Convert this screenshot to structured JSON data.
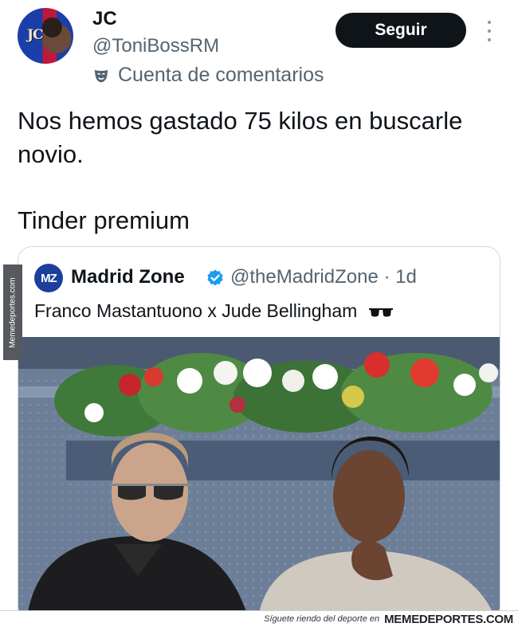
{
  "author": {
    "avatar_text": "JC",
    "display_name": "JC",
    "handle": "@ToniBossRM",
    "account_label": "Cuenta de comentarios",
    "account_label_icon": "mask-icon"
  },
  "actions": {
    "follow_label": "Seguir",
    "more_icon": "more-vertical-icon"
  },
  "tweet": {
    "lines": [
      "Nos hemos gastado 75 kilos en buscarle",
      "novio.",
      "Tinder premium"
    ]
  },
  "quote": {
    "logo_text": "MZ",
    "name": "Madrid Zone",
    "verified_icon": "verified-badge-icon",
    "handle_time": "@theMadridZone · 1d",
    "text": "Franco Mastantuono x Jude Bellingham",
    "emoji_icon": "sunglasses-icon"
  },
  "watermark": {
    "side_text": "Memedeportes.com",
    "footer_text": "Síguete riendo del deporte en",
    "footer_brand": "MEMEDEPORTES.COM"
  },
  "colors": {
    "text_primary": "#0f1419",
    "text_secondary": "#536471",
    "button_bg": "#0f1419",
    "verified": "#1d9bf0",
    "border": "#cfd9de"
  }
}
